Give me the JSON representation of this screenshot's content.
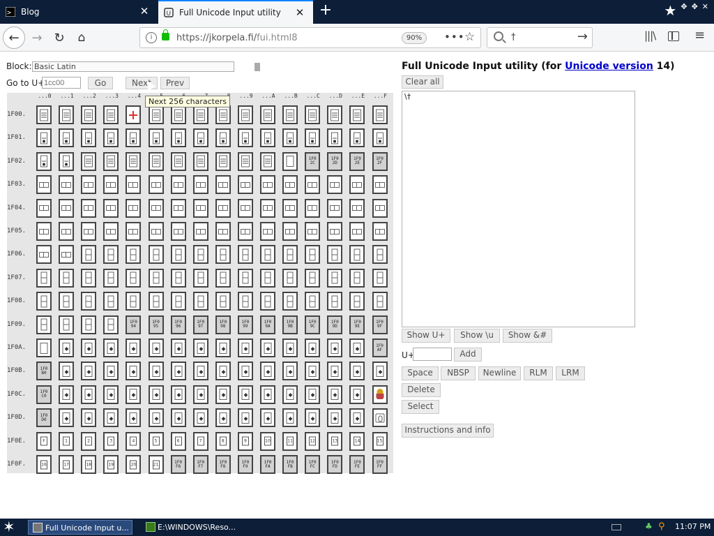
{
  "tabs": [
    {
      "label": "Blog"
    },
    {
      "label": "Full Unicode Input utility"
    }
  ],
  "window_controls": [
    "★",
    "✥",
    "✥",
    "✕"
  ],
  "nav": {
    "url_host": "https://jkorpela.fi/",
    "url_path": "fui.html8",
    "zoom": "90%",
    "search_value": "†"
  },
  "page": {
    "block_label": "Block:",
    "block_value": "Basic Latin",
    "goto_label": "Go to U+",
    "goto_placeholder": "1cc00",
    "go_label": "Go",
    "next_label": "Next",
    "prev_label": "Prev",
    "tooltip": "Next 256 characters",
    "title_prefix": "Full Unicode Input utility (for ",
    "title_link": "Unicode version",
    "title_suffix": " 14)",
    "clear_label": "Clear all",
    "textarea_value": "\\†",
    "show_u_label": "Show U+",
    "show_slash_label": "Show \\u",
    "show_amp_label": "Show &#",
    "u_plus_label": "U+",
    "add_label": "Add",
    "space_label": "Space",
    "nbsp_label": "NBSP",
    "newline_label": "Newline",
    "rlm_label": "RLM",
    "lrm_label": "LRM",
    "delete_label": "Delete",
    "select_label": "Select",
    "info_label": "Instructions and info"
  },
  "grid": {
    "column_headers": [
      "...0",
      "...1",
      "...2",
      "...3",
      "...4",
      "...5",
      "...6",
      "...7",
      "...8",
      "...9",
      "...A",
      "...B",
      "...C",
      "...D",
      "...E",
      "...F"
    ],
    "rows": [
      {
        "label": "1F00.",
        "cells": [
          "mj",
          "mj",
          "mj",
          "mj",
          "red",
          "mj",
          "mj",
          "mj",
          "mj",
          "mj",
          "mj",
          "mj",
          "mj",
          "mj",
          "mj",
          "mj"
        ]
      },
      {
        "label": "1F01.",
        "cells": [
          "dom",
          "dom",
          "dom",
          "dom",
          "dom",
          "dom",
          "dom",
          "dom",
          "dom",
          "dom",
          "dom",
          "dom",
          "dom",
          "dom",
          "dom",
          "dom"
        ]
      },
      {
        "label": "1F02.",
        "cells": [
          "dom",
          "dom",
          "mj",
          "mj",
          "mj",
          "mj",
          "mj",
          "mj",
          "mj",
          "mj",
          "mj",
          "back",
          "hex:1F02C",
          "hex:1F02D",
          "hex:1F02E",
          "hex:1F02F"
        ]
      },
      {
        "label": "1F03.",
        "cells": [
          "wide",
          "wide",
          "wide",
          "wide",
          "wide",
          "wide",
          "wide",
          "wide",
          "wide",
          "wide",
          "wide",
          "wide",
          "wide",
          "wide",
          "wide",
          "wide"
        ]
      },
      {
        "label": "1F04.",
        "cells": [
          "wide",
          "wide",
          "wide",
          "wide",
          "wide",
          "wide",
          "wide",
          "wide",
          "wide",
          "wide",
          "wide",
          "wide",
          "wide",
          "wide",
          "wide",
          "wide"
        ]
      },
      {
        "label": "1F05.",
        "cells": [
          "wide",
          "wide",
          "wide",
          "wide",
          "wide",
          "wide",
          "wide",
          "wide",
          "wide",
          "wide",
          "wide",
          "wide",
          "wide",
          "wide",
          "wide",
          "wide"
        ]
      },
      {
        "label": "1F06.",
        "cells": [
          "wide",
          "wide",
          "vdom",
          "vdom",
          "vdom",
          "vdom",
          "vdom",
          "vdom",
          "vdom",
          "vdom",
          "vdom",
          "vdom",
          "vdom",
          "vdom",
          "vdom",
          "vdom"
        ]
      },
      {
        "label": "1F07.",
        "cells": [
          "vdom",
          "vdom",
          "vdom",
          "vdom",
          "vdom",
          "vdom",
          "vdom",
          "vdom",
          "vdom",
          "vdom",
          "vdom",
          "vdom",
          "vdom",
          "vdom",
          "vdom",
          "vdom"
        ]
      },
      {
        "label": "1F08.",
        "cells": [
          "vdom",
          "vdom",
          "vdom",
          "vdom",
          "vdom",
          "vdom",
          "vdom",
          "vdom",
          "vdom",
          "vdom",
          "vdom",
          "vdom",
          "vdom",
          "vdom",
          "vdom",
          "vdom"
        ]
      },
      {
        "label": "1F09.",
        "cells": [
          "vdom",
          "vdom",
          "vdom",
          "vdom",
          "hex:1F094",
          "hex:1F095",
          "hex:1F096",
          "hex:1F097",
          "hex:1F098",
          "hex:1F099",
          "hex:1F09A",
          "hex:1F09B",
          "hex:1F09C",
          "hex:1F09D",
          "hex:1F09E",
          "hex:1F09F"
        ]
      },
      {
        "label": "1F0A.",
        "cells": [
          "back",
          "card",
          "card",
          "card",
          "card",
          "card",
          "card",
          "card",
          "card",
          "card",
          "card",
          "card",
          "card",
          "card",
          "card",
          "hex:1F0AF"
        ]
      },
      {
        "label": "1F0B.",
        "cells": [
          "hex:1F0B0",
          "card",
          "card",
          "card",
          "card",
          "card",
          "card",
          "card",
          "card",
          "card",
          "card",
          "card",
          "card",
          "card",
          "card",
          "card"
        ]
      },
      {
        "label": "1F0C.",
        "cells": [
          "hex:1F0C0",
          "card",
          "card",
          "card",
          "card",
          "card",
          "card",
          "card",
          "card",
          "card",
          "card",
          "card",
          "card",
          "card",
          "card",
          "joker"
        ]
      },
      {
        "label": "1F0D.",
        "cells": [
          "hex:1F0D0",
          "card",
          "card",
          "card",
          "card",
          "card",
          "card",
          "card",
          "card",
          "card",
          "card",
          "card",
          "card",
          "card",
          "card",
          "squig"
        ]
      },
      {
        "label": "1F0E.",
        "cells": [
          "box:F",
          "box:1",
          "box:2",
          "box:3",
          "box:4",
          "box:5",
          "box:6",
          "box:7",
          "box:8",
          "box:9",
          "box:10",
          "box:11",
          "box:12",
          "box:13",
          "box:14",
          "box:15"
        ]
      },
      {
        "label": "1F0F.",
        "cells": [
          "box:16",
          "box:17",
          "box:18",
          "box:19",
          "box:20",
          "box:21",
          "hex:1F0F6",
          "hex:1F0F7",
          "hex:1F0F8",
          "hex:1F0F9",
          "hex:1F0FA",
          "hex:1F0FB",
          "hex:1F0FC",
          "hex:1F0FD",
          "hex:1F0FE",
          "hex:1F0FF"
        ]
      }
    ]
  },
  "taskbar": {
    "tasks": [
      {
        "label": "Full Unicode Input u..."
      },
      {
        "label": "E:\\WINDOWS\\Reso..."
      }
    ],
    "clock": "11:07 PM"
  },
  "colors": {
    "tabbar_bg": "#0c1e38",
    "link": "#0000cc",
    "gray_cell": "#d2d2d2"
  }
}
